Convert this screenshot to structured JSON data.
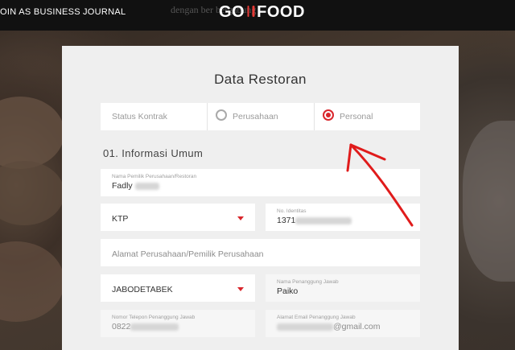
{
  "nav": {
    "join_label": "OIN AS BUSINESS",
    "journal_label": "JOURNAL",
    "background_text": "dengan ber                                  bergabung"
  },
  "logo": {
    "text_left": "GO",
    "text_right": "FOOD",
    "icon": "fork-knife-icon"
  },
  "form": {
    "title": "Data Restoran",
    "contract": {
      "label": "Status Kontrak",
      "options": [
        "Perusahaan",
        "Personal"
      ],
      "selected": "Personal"
    },
    "section_title": "01. Informasi Umum",
    "owner_name": {
      "label": "Nama Pemilik Perusahaan/Restoran",
      "value": "Fadly"
    },
    "id_type": {
      "value": "KTP"
    },
    "id_number": {
      "label": "No. Identitas",
      "value": "1371"
    },
    "address": {
      "placeholder": "Alamat Perusahaan/Pemilik Perusahaan"
    },
    "region": {
      "value": "JABODETABEK"
    },
    "pic_name": {
      "label": "Nama Penanggung Jawab",
      "value": "Paiko"
    },
    "pic_phone": {
      "label": "Nomor Telepon Penanggung Jawab",
      "value": "0822"
    },
    "pic_email": {
      "label": "Alamat Email Penanggung Jawab",
      "value": "@gmail.com"
    }
  },
  "colors": {
    "accent": "#d9262c",
    "topbar": "#111111",
    "card": "#efefef"
  }
}
